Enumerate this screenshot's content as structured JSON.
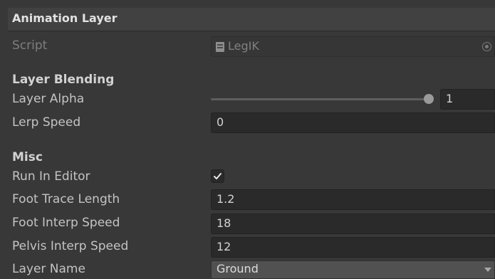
{
  "component": {
    "title": "Animation Layer"
  },
  "script": {
    "label": "Script",
    "value": "LegIK",
    "icon": "script-icon"
  },
  "sections": {
    "layer_blending": "Layer Blending",
    "misc": "Misc"
  },
  "layer_alpha": {
    "label": "Layer Alpha",
    "value": "1",
    "slider_fraction": 1.0
  },
  "lerp_speed": {
    "label": "Lerp Speed",
    "value": "0"
  },
  "run_in_editor": {
    "label": "Run In Editor",
    "checked": true
  },
  "foot_trace_length": {
    "label": "Foot Trace Length",
    "value": "1.2"
  },
  "foot_interp_speed": {
    "label": "Foot Interp Speed",
    "value": "18"
  },
  "pelvis_interp_speed": {
    "label": "Pelvis Interp Speed",
    "value": "12"
  },
  "layer_name": {
    "label": "Layer Name",
    "value": "Ground"
  }
}
